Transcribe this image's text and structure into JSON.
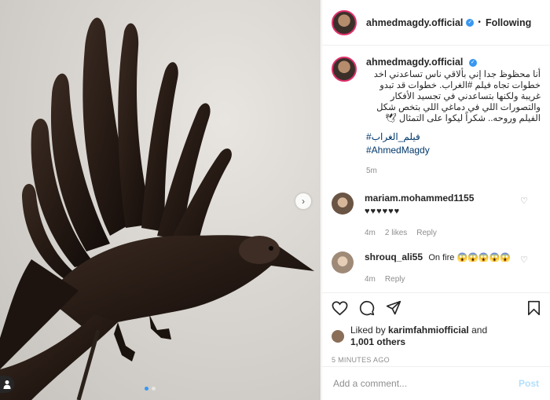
{
  "post": {
    "username": "ahmedmagdy.official",
    "follow_status": "Following",
    "separator": "•",
    "verified_mark": "✓"
  },
  "caption": {
    "username": "ahmedmagdy.official",
    "text": "أنا محظوظ جدا إني بألاقي ناس تساعدني اخد خطوات تجاه فيلم #الغراب. خطوات قد تبدو غريبة ولكنها بتساعدني في تجسيد الأفكار والتصورات اللي في دماغي اللي بتخص شكل الفيلم وروحه.. شكراً ليكوا على التمثال 🕊",
    "hashtag_ar": "#فيلم_الغراب",
    "hashtag_en": "#AhmedMagdy",
    "time": "5m"
  },
  "comments": [
    {
      "username": "mariam.mohammed1155",
      "text": "♥♥♥♥♥♥",
      "time": "4m",
      "likes": "2 likes",
      "reply": "Reply"
    },
    {
      "username": "shrouq_ali55",
      "text": "On fire 😱😱😱😱😱",
      "time": "4m",
      "likes": "",
      "reply": "Reply"
    }
  ],
  "likes": {
    "prefix": "Liked by",
    "user": "karimfahmiofficial",
    "and": "and",
    "others": "1,001 others"
  },
  "posted_time": "5 MINUTES AGO",
  "add_comment": {
    "placeholder": "Add a comment...",
    "post_label": "Post"
  },
  "carousel": {
    "next_glyph": "›",
    "pages": 2,
    "active_page": 1
  },
  "icons": {
    "like": "heart-icon",
    "comment": "comment-icon",
    "share": "share-icon",
    "save": "bookmark-icon",
    "next": "chevron-right-icon",
    "tag": "user-tag-icon"
  },
  "colors": {
    "link": "#00376b",
    "verified": "#3897f0",
    "muted": "#8e8e8e",
    "post_button": "#b2dffc"
  }
}
